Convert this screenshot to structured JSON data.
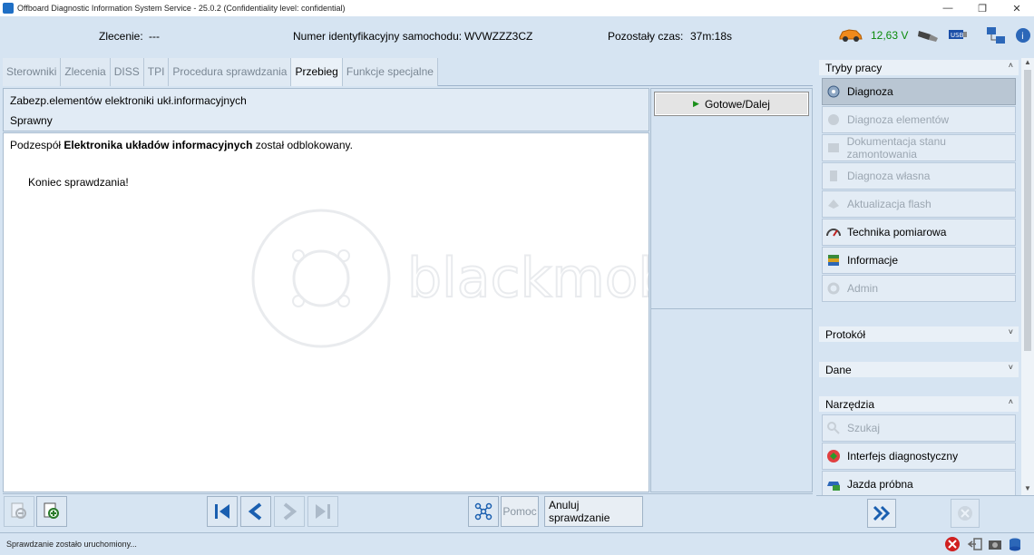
{
  "window": {
    "title": "Offboard Diagnostic Information System Service - 25.0.2 (Confidentiality level: confidential)",
    "minimize_icon": "minimize-icon",
    "maximize_icon": "restore-icon",
    "close_icon": "close-icon"
  },
  "infobar": {
    "order_label": "Zlecenie:",
    "order_value": "---",
    "vin_label": "Numer identyfikacyjny samochodu:",
    "vin_value": "WVWZZZ3CZ",
    "time_label": "Pozostały czas:",
    "time_value": "37m:18s",
    "voltage": "12,63 V",
    "voltage_color": "#0a8a0a"
  },
  "tabs": [
    {
      "label": "Sterowniki",
      "active": false
    },
    {
      "label": "Zlecenia",
      "active": false
    },
    {
      "label": "DISS",
      "active": false
    },
    {
      "label": "TPI",
      "active": false
    },
    {
      "label": "Procedura sprawdzania",
      "active": false
    },
    {
      "label": "Przebieg",
      "active": true
    },
    {
      "label": "Funkcje specjalne",
      "active": false
    }
  ],
  "header": {
    "title": "Zabezp.elementów elektroniki ukł.informacyjnych",
    "status": "Sprawny"
  },
  "content": {
    "msg_prefix": "Podzespół ",
    "msg_bold": "Elektronika układów informacyjnych",
    "msg_suffix": " został odblokowany.",
    "end_text": "Koniec sprawdzania!",
    "watermark": "blackmobile"
  },
  "next_button": "Gotowe/Dalej",
  "bottombar": {
    "help_label": "Pomoc",
    "cancel_label": "Anuluj sprawdzanie"
  },
  "sidepanel": {
    "modes_title": "Tryby pracy",
    "modes": [
      {
        "label": "Diagnoza",
        "state": "selected"
      },
      {
        "label": "Diagnoza elementów",
        "state": "disabled"
      },
      {
        "label": "Dokumentacja stanu zamontowania",
        "state": "disabled"
      },
      {
        "label": "Diagnoza własna",
        "state": "disabled"
      },
      {
        "label": "Aktualizacja flash",
        "state": "disabled"
      },
      {
        "label": "Technika pomiarowa",
        "state": "enabled"
      },
      {
        "label": "Informacje",
        "state": "enabled"
      },
      {
        "label": "Admin",
        "state": "disabled"
      }
    ],
    "protocol_title": "Protokół",
    "data_title": "Dane",
    "tools_title": "Narzędzia",
    "tools": [
      {
        "label": "Szukaj",
        "state": "disabled"
      },
      {
        "label": "Interfejs diagnostyczny",
        "state": "enabled"
      },
      {
        "label": "Jazda próbna",
        "state": "enabled"
      }
    ]
  },
  "status": {
    "text": "Sprawdzanie zostało uruchomiony..."
  }
}
